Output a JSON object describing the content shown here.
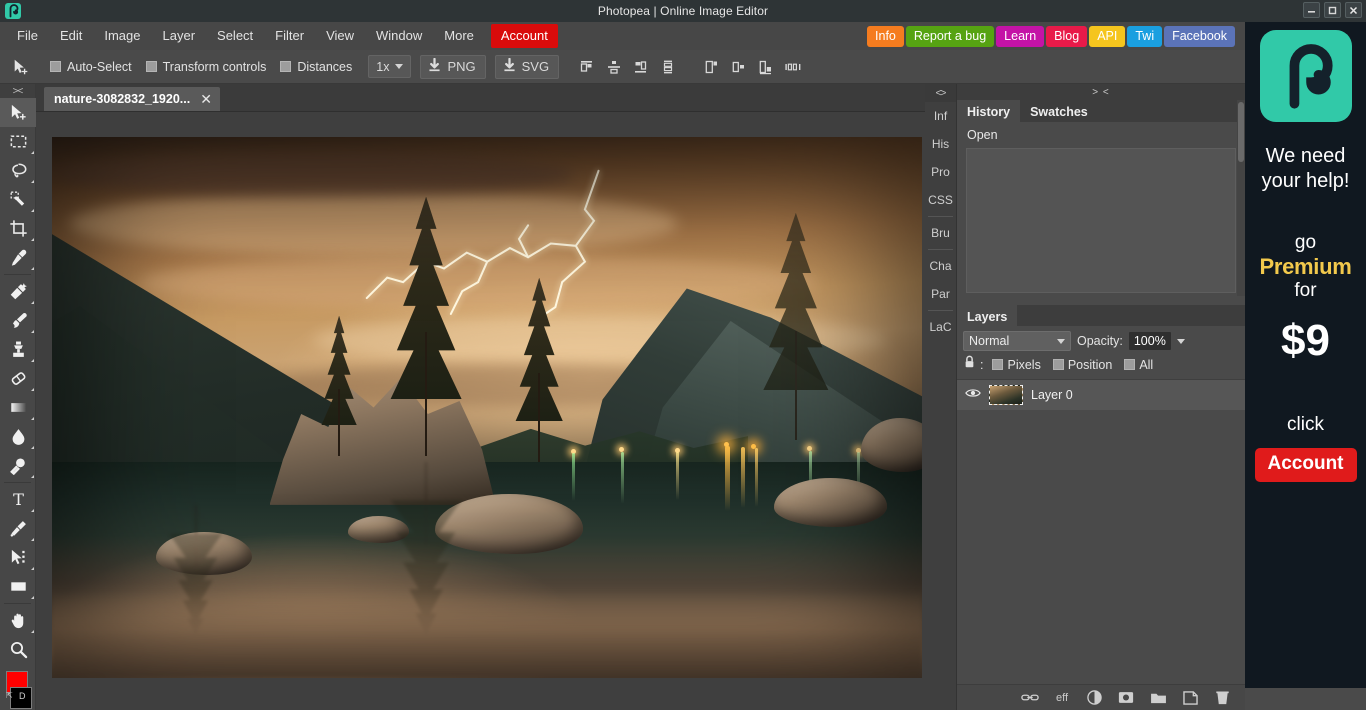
{
  "window": {
    "title": "Photopea | Online Image Editor",
    "app_icon": "photopea-logo-icon",
    "minimize_label": "–",
    "maximize_label": "□",
    "close_label": "✕"
  },
  "menubar": {
    "items": [
      {
        "label": "File"
      },
      {
        "label": "Edit"
      },
      {
        "label": "Image"
      },
      {
        "label": "Layer"
      },
      {
        "label": "Select"
      },
      {
        "label": "Filter"
      },
      {
        "label": "View"
      },
      {
        "label": "Window"
      },
      {
        "label": "More"
      },
      {
        "label": "Account",
        "accent": "#d90b0b"
      }
    ],
    "links": [
      {
        "label": "Info",
        "color": "#f57c1f"
      },
      {
        "label": "Report a bug",
        "color": "#56a312"
      },
      {
        "label": "Learn",
        "color": "#c413a6"
      },
      {
        "label": "Blog",
        "color": "#e81a49"
      },
      {
        "label": "API",
        "color": "#f5c51e"
      },
      {
        "label": "Twi",
        "color": "#1a9fe0"
      },
      {
        "label": "Facebook",
        "color": "#5b73b8"
      }
    ]
  },
  "options_bar": {
    "tool_icon": "move-tool-icon",
    "checkboxes": [
      {
        "label": "Auto-Select",
        "checked": true
      },
      {
        "label": "Transform controls",
        "checked": true
      },
      {
        "label": "Distances",
        "checked": true
      }
    ],
    "zoom": {
      "value": "1x",
      "icon": "chevron-down-icon"
    },
    "downloads": [
      {
        "label": "PNG",
        "icon": "download-icon"
      },
      {
        "label": "SVG",
        "icon": "download-icon"
      }
    ],
    "align_group_1": [
      "align-top-icon",
      "align-vertical-center-icon",
      "align-bottom-icon",
      "distribute-vertical-icon"
    ],
    "align_group_2": [
      "align-left-icon",
      "align-horizontal-center-icon",
      "align-right-icon",
      "distribute-horizontal-icon"
    ]
  },
  "toolbar": {
    "collapse_label": "><",
    "tools": [
      {
        "name": "move-tool",
        "icon": "move-tool-icon",
        "active": true
      },
      {
        "name": "rectangular-marquee-tool",
        "icon": "marquee-icon"
      },
      {
        "name": "lasso-tool",
        "icon": "lasso-icon"
      },
      {
        "name": "magic-wand-tool",
        "icon": "magic-wand-icon"
      },
      {
        "name": "crop-tool",
        "icon": "crop-icon"
      },
      {
        "name": "eyedropper-tool",
        "icon": "eyedropper-icon"
      },
      {
        "name": "spot-healing-brush-tool",
        "icon": "healing-brush-icon"
      },
      {
        "name": "brush-tool",
        "icon": "brush-icon"
      },
      {
        "name": "clone-stamp-tool",
        "icon": "stamp-icon"
      },
      {
        "name": "eraser-tool",
        "icon": "eraser-icon"
      },
      {
        "name": "gradient-tool",
        "icon": "gradient-icon"
      },
      {
        "name": "blur-tool",
        "icon": "water-drop-icon"
      },
      {
        "name": "dodge-tool",
        "icon": "dodge-icon"
      },
      {
        "name": "type-tool",
        "icon": "type-icon"
      },
      {
        "name": "pen-tool",
        "icon": "pen-icon"
      },
      {
        "name": "path-selection-tool",
        "icon": "path-select-icon"
      },
      {
        "name": "shape-tool",
        "icon": "rectangle-shape-icon"
      },
      {
        "name": "hand-tool",
        "icon": "hand-icon"
      },
      {
        "name": "zoom-tool",
        "icon": "magnifier-icon"
      }
    ],
    "foreground_color": "#ff0000",
    "background_color": "#000000",
    "reset_label": "⇱",
    "default_label": "D"
  },
  "document_tabs": [
    {
      "title": "nature-3082832_1920...",
      "close_label": "✕",
      "active": true
    }
  ],
  "side_tabs": {
    "collapse_label": "<>",
    "groups": [
      [
        "Inf",
        "His",
        "Pro",
        "CSS"
      ],
      [
        "Bru"
      ],
      [
        "Cha",
        "Par"
      ],
      [
        "LaC"
      ]
    ]
  },
  "panels": {
    "collapse_label": "> <",
    "history": {
      "tabs": [
        {
          "label": "History",
          "active": true
        },
        {
          "label": "Swatches",
          "active": false
        }
      ],
      "entries": [
        "Open"
      ]
    },
    "layers": {
      "tabs": [
        {
          "label": "Layers",
          "active": true
        }
      ],
      "blend_mode": "Normal",
      "blend_caret": "chevron-down-icon",
      "opacity_label": "Opacity:",
      "opacity_value": "100%",
      "opacity_caret": "chevron-down-icon",
      "lock_icon": "lock-icon",
      "lock_label": ":",
      "lock_options": [
        {
          "label": "Pixels"
        },
        {
          "label": "Position"
        },
        {
          "label": "All"
        }
      ],
      "rows": [
        {
          "name": "Layer 0",
          "visible": true,
          "visibility_icon": "eye-icon",
          "selected": true
        }
      ],
      "footer_icons": [
        {
          "name": "link-layers-icon",
          "label": ""
        },
        {
          "name": "layer-effects-icon",
          "label": "eff"
        },
        {
          "name": "adjustment-layer-icon",
          "label": ""
        },
        {
          "name": "layer-mask-icon",
          "label": ""
        },
        {
          "name": "new-group-icon",
          "label": ""
        },
        {
          "name": "new-layer-icon",
          "label": ""
        },
        {
          "name": "delete-layer-icon",
          "label": ""
        }
      ]
    }
  },
  "ad": {
    "logo_icon": "photopea-logo-icon",
    "headline_line1": "We need",
    "headline_line2": "your help!",
    "go_label": "go",
    "premium_label": "Premium",
    "for_label": "for",
    "price": "$9",
    "click_label": "click",
    "button_label": "Account",
    "accent_color": "#31c9a8",
    "premium_color": "#f2c94c",
    "button_color": "#e01b1b"
  },
  "canvas": {
    "image_name": "nature-3082832_1920",
    "description": "Dramatic golden storm sky with lightning over a dark alpine lake, pine trees on a rocky island, village lights reflected in still water"
  }
}
